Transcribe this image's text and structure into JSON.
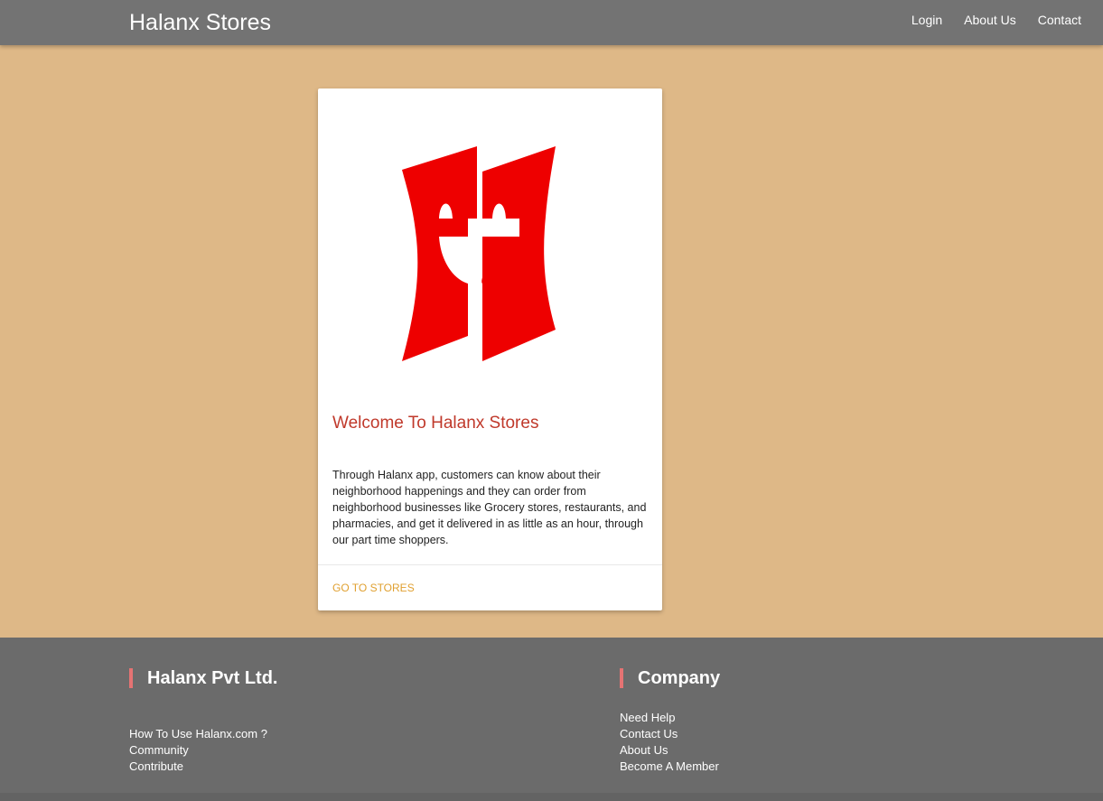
{
  "header": {
    "brand": "Halanx Stores",
    "nav": [
      {
        "label": "Login"
      },
      {
        "label": "About Us"
      },
      {
        "label": "Contact"
      }
    ]
  },
  "card": {
    "logo_icon": "halanx-smiling-h-logo",
    "logo_color": "#ee0000",
    "title": "Welcome To Halanx Stores",
    "text": "Through Halanx app, customers can know about their neighborhood happenings and they can order from neighborhood businesses like Grocery stores, restaurants, and pharmacies, and get it delivered in as little as an hour, through our part time shoppers.",
    "action": "GO TO STORES"
  },
  "footer": {
    "left": {
      "heading": "Halanx Pvt Ltd.",
      "links": [
        "How To Use Halanx.com ?",
        "Community",
        "Contribute"
      ]
    },
    "right": {
      "heading": "Company",
      "links": [
        "Need Help",
        "Contact Us",
        "About Us",
        "Become A Member"
      ]
    }
  },
  "colors": {
    "page_background": "#deb887",
    "header_background": "#737373",
    "footer_background": "#6b6b6b",
    "title_color": "#c0392b",
    "action_color": "#e0a030",
    "footer_accent": "#e57373"
  }
}
